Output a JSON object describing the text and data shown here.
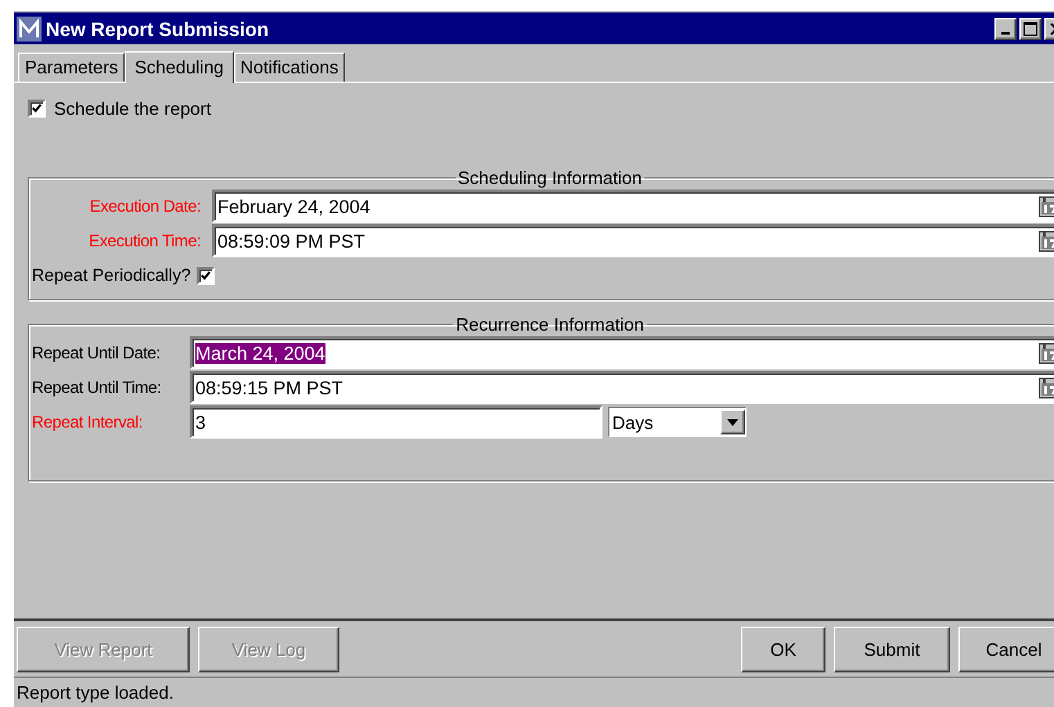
{
  "window": {
    "title": "New Report Submission"
  },
  "tabs": [
    {
      "label": "Parameters",
      "selected": false
    },
    {
      "label": "Scheduling",
      "selected": true
    },
    {
      "label": "Notifications",
      "selected": false
    }
  ],
  "schedule_checkbox": {
    "label": "Schedule the report",
    "checked": true
  },
  "scheduling": {
    "title": "Scheduling Information",
    "fields": [
      {
        "kind": "date",
        "label": "Execution Date:",
        "required": true,
        "value": "February 24, 2004",
        "selected": false
      },
      {
        "kind": "date",
        "label": "Execution Time:",
        "required": true,
        "value": "08:59:09 PM PST",
        "selected": false
      }
    ],
    "repeat": {
      "label": "Repeat Periodically?",
      "checked": true
    }
  },
  "recurrence": {
    "title": "Recurrence Information",
    "fields": [
      {
        "kind": "date",
        "label": "Repeat Until Date:",
        "required": false,
        "value": "March 24, 2004",
        "selected": true
      },
      {
        "kind": "date",
        "label": "Repeat Until Time:",
        "required": false,
        "value": "08:59:15 PM PST",
        "selected": false
      },
      {
        "kind": "interval",
        "label": "Repeat Interval:",
        "required": true,
        "value": "3",
        "selected": false,
        "unit": "Days"
      }
    ]
  },
  "buttons": [
    {
      "label": "View Report",
      "disabled": true
    },
    {
      "label": "View Log",
      "disabled": true
    },
    {
      "label": "OK",
      "disabled": false
    },
    {
      "label": "Submit",
      "disabled": false
    },
    {
      "label": "Cancel",
      "disabled": false
    }
  ],
  "status_bar": "Report type loaded."
}
